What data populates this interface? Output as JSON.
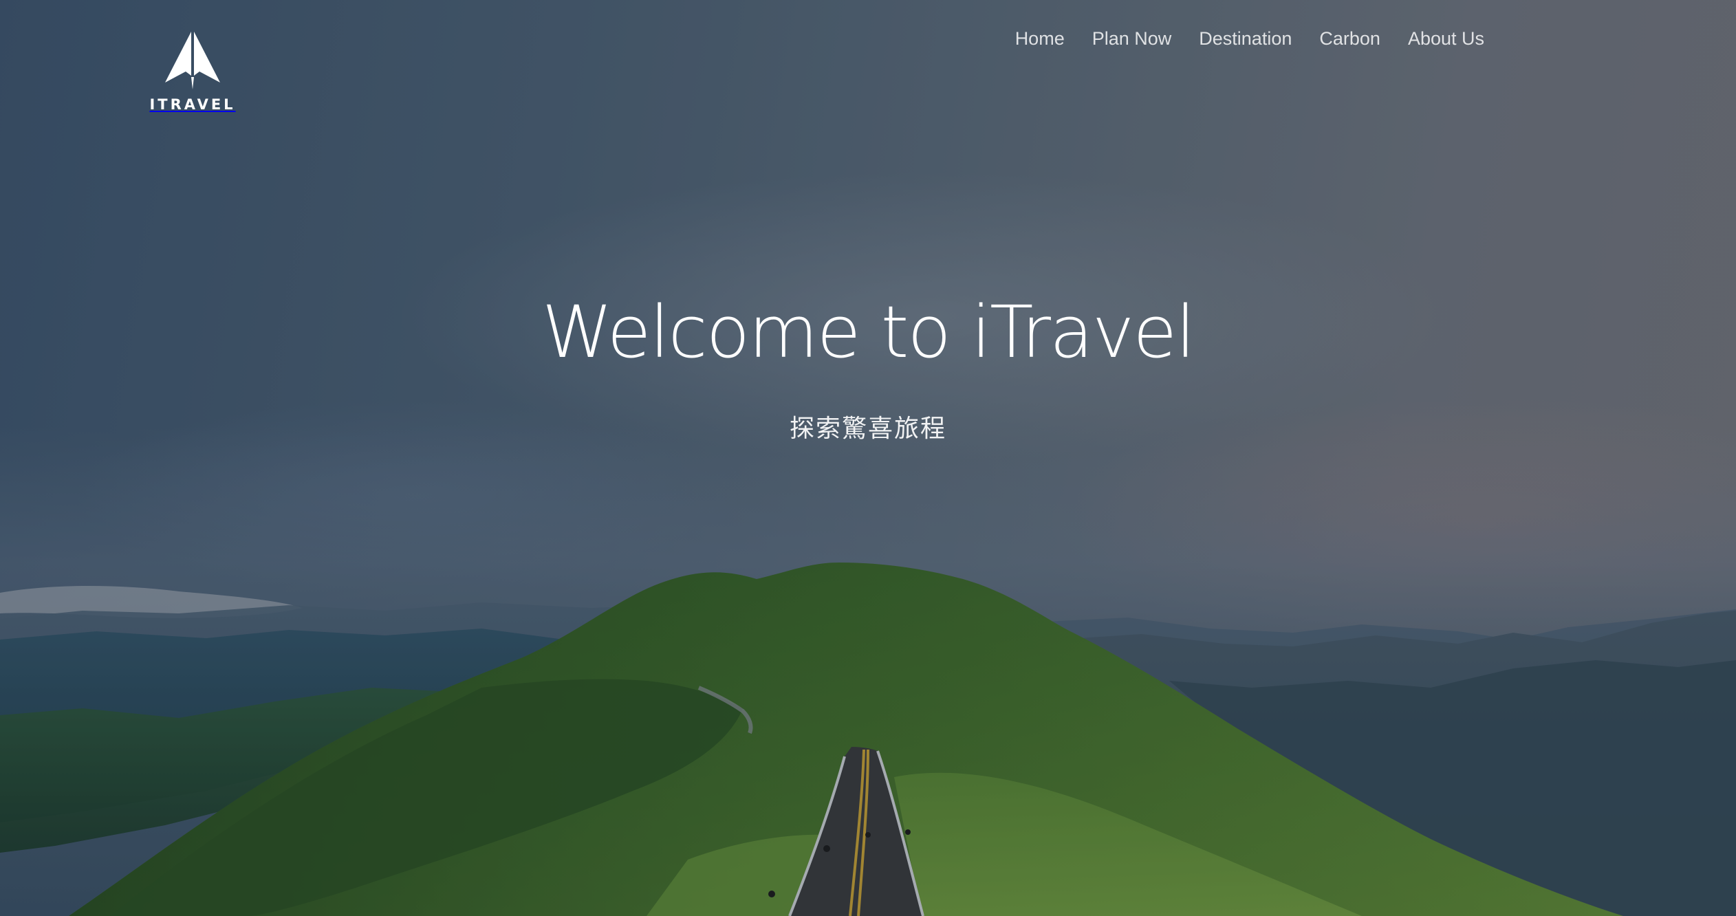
{
  "brand": {
    "logo_text": "ITRAVEL"
  },
  "nav": {
    "items": [
      {
        "label": "Home"
      },
      {
        "label": "Plan Now"
      },
      {
        "label": "Destination"
      },
      {
        "label": "Carbon"
      },
      {
        "label": "About Us"
      }
    ]
  },
  "hero": {
    "title": "Welcome to iTravel",
    "subtitle": "探索驚喜旅程",
    "background_image": "mountain-ridge-road-landscape"
  },
  "colors": {
    "text": "#ffffff",
    "sky": "#4d6276",
    "hill": "#3f6a2a",
    "road": "#3a3b3d",
    "road_line": "#c9a335"
  }
}
